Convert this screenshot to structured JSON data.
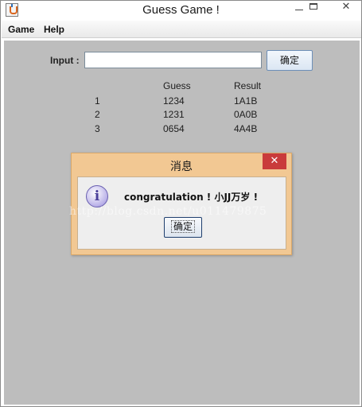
{
  "window": {
    "title": "Guess Game !",
    "minimize_glyph": "",
    "close_glyph": "✕"
  },
  "menu": {
    "game": "Game",
    "help": "Help"
  },
  "input": {
    "label": "Input :",
    "value": "",
    "confirm_label": "确定"
  },
  "history": {
    "headers": {
      "guess": "Guess",
      "result": "Result"
    },
    "rows": [
      {
        "index": "1",
        "guess": "1234",
        "result": "1A1B"
      },
      {
        "index": "2",
        "guess": "1231",
        "result": "0A0B"
      },
      {
        "index": "3",
        "guess": "0654",
        "result": "4A4B"
      }
    ]
  },
  "dialog": {
    "title": "消息",
    "close_glyph": "✕",
    "info_glyph": "i",
    "message": "congratulation ! 小JJ万岁 !",
    "ok_label": "确定"
  },
  "watermark": "http://blog.csdn.net/u011479875",
  "colors": {
    "content_bg": "#bdbdbd",
    "dialog_frame": "#f2c893",
    "dialog_close": "#c93b3b"
  }
}
